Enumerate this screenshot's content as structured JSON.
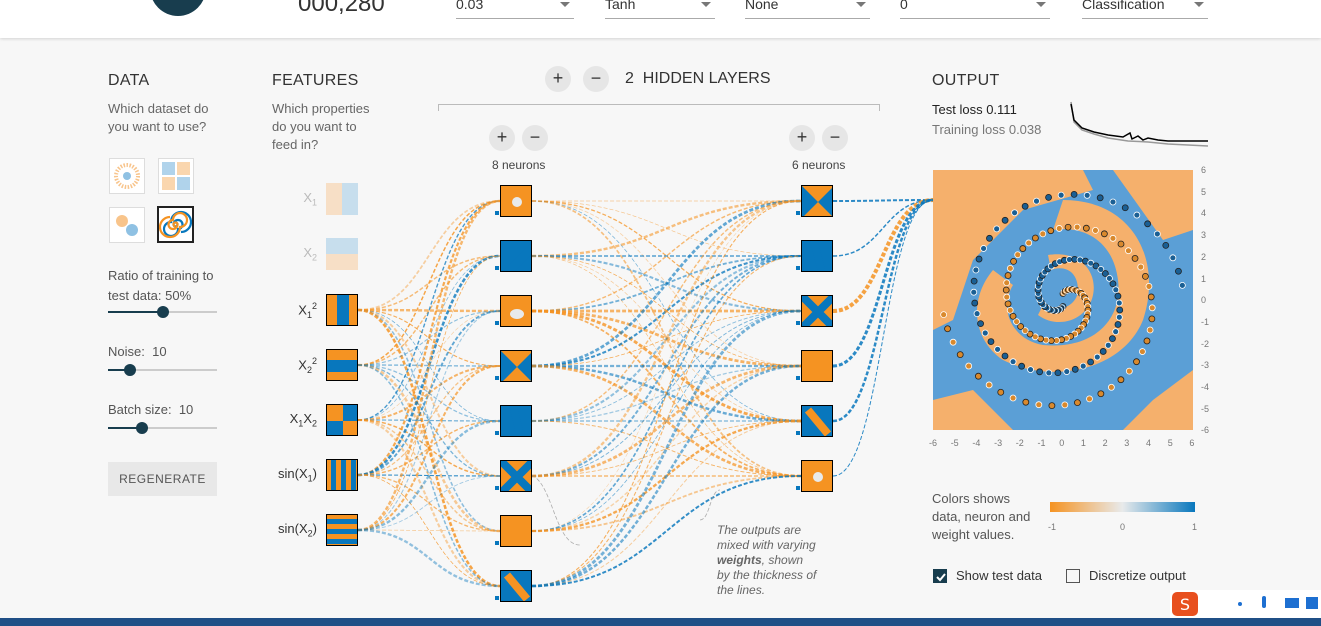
{
  "header": {
    "epoch": "000,280",
    "learning_rate": "0.03",
    "activation": "Tanh",
    "regularization": "None",
    "regularization_rate": "0",
    "problem_type": "Classification"
  },
  "data_panel": {
    "title": "DATA",
    "question": "Which dataset do you want to use?",
    "ratio_label": "Ratio of training to test data:",
    "ratio_value": "50%",
    "ratio_fraction": 0.5,
    "noise_label": "Noise:",
    "noise_value": "10",
    "noise_fraction": 0.2,
    "batch_label": "Batch size:",
    "batch_value": "10",
    "batch_fraction": 0.31,
    "regenerate_label": "REGENERATE"
  },
  "features_panel": {
    "title": "FEATURES",
    "question": "Which properties do you want to feed in?",
    "features": [
      {
        "base": "X",
        "sub": "1",
        "sup": "",
        "suffix": "",
        "enabled": false
      },
      {
        "base": "X",
        "sub": "2",
        "sup": "",
        "suffix": "",
        "enabled": false
      },
      {
        "base": "X",
        "sub": "1",
        "sup": "2",
        "suffix": "",
        "enabled": true
      },
      {
        "base": "X",
        "sub": "2",
        "sup": "2",
        "suffix": "",
        "enabled": true
      },
      {
        "base": "X",
        "sub": "1",
        "sup": "",
        "suffix": "X",
        "sub2": "2",
        "enabled": true
      },
      {
        "base": "sin(X",
        "sub": "1",
        "sup": "",
        "suffix": ")",
        "enabled": true
      },
      {
        "base": "sin(X",
        "sub": "2",
        "sup": "",
        "suffix": ")",
        "enabled": true
      }
    ]
  },
  "network": {
    "hidden_layers_count": "2",
    "hidden_layers_label": "HIDDEN LAYERS",
    "layer1_neurons_label": "8 neurons",
    "layer2_neurons_label": "6 neurons",
    "callout_pre": "The outputs are mixed with varying ",
    "callout_bold": "weights",
    "callout_post": ", shown by the thickness of the lines."
  },
  "output_panel": {
    "title": "OUTPUT",
    "test_loss_label": "Test loss",
    "test_loss_value": "0.111",
    "training_loss_label": "Training loss",
    "training_loss_value": "0.038",
    "y_ticks": [
      "6",
      "5",
      "4",
      "3",
      "2",
      "1",
      "0",
      "-1",
      "-2",
      "-3",
      "-4",
      "-5",
      "-6"
    ],
    "x_ticks": [
      "-6",
      "-5",
      "-4",
      "-3",
      "-2",
      "-1",
      "0",
      "1",
      "2",
      "3",
      "4",
      "5",
      "6"
    ],
    "legend_text": "Colors shows data, neuron and weight values.",
    "legend_ticks": [
      "-1",
      "0",
      "1"
    ],
    "show_test_data_label": "Show test data",
    "show_test_data_checked": true,
    "discretize_label": "Discretize output",
    "discretize_checked": false
  },
  "colors": {
    "orange": "#f59322",
    "blue": "#0877bd",
    "light_orange": "#f8c48b",
    "light_blue": "#8fc1e3",
    "dark": "#183d4e"
  }
}
